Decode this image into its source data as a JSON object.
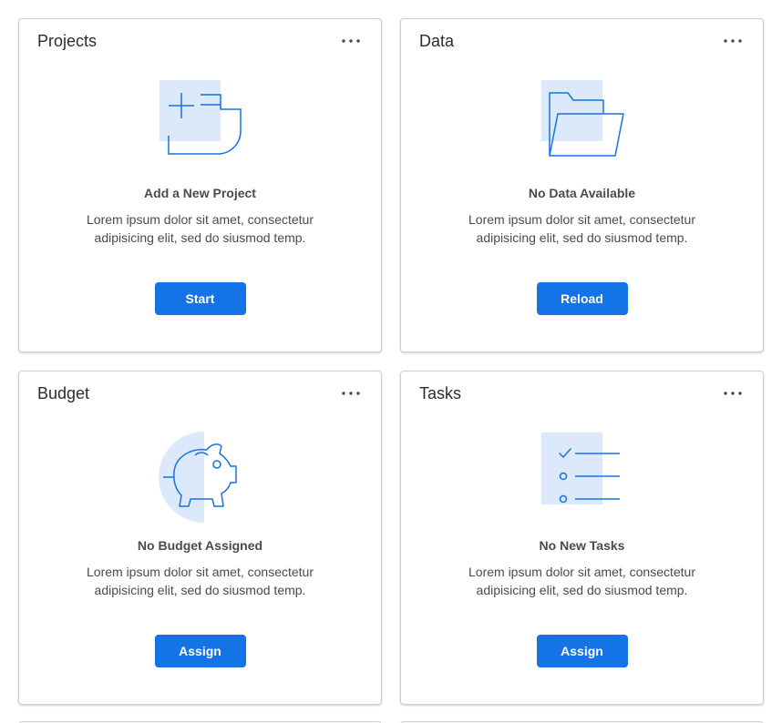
{
  "colors": {
    "accent": "#1473e6",
    "illustration_fill": "#dbe9fb",
    "border": "#cfcfcf"
  },
  "cards": [
    {
      "title": "Projects",
      "icon": "add-project-icon",
      "heading": "Add a New Project",
      "description": "Lorem ipsum dolor sit amet, consectetur adipisicing elit, sed do siusmod temp.",
      "button": "Start"
    },
    {
      "title": "Data",
      "icon": "folder-icon",
      "heading": "No Data Available",
      "description": "Lorem ipsum dolor sit amet, consectetur adipisicing elit, sed do siusmod temp.",
      "button": "Reload"
    },
    {
      "title": "Budget",
      "icon": "piggy-bank-icon",
      "heading": "No Budget Assigned",
      "description": "Lorem ipsum dolor sit amet, consectetur adipisicing elit, sed do siusmod temp.",
      "button": "Assign"
    },
    {
      "title": "Tasks",
      "icon": "task-list-icon",
      "heading": "No New Tasks",
      "description": "Lorem ipsum dolor sit amet, consectetur adipisicing elit, sed do siusmod temp.",
      "button": "Assign"
    }
  ]
}
